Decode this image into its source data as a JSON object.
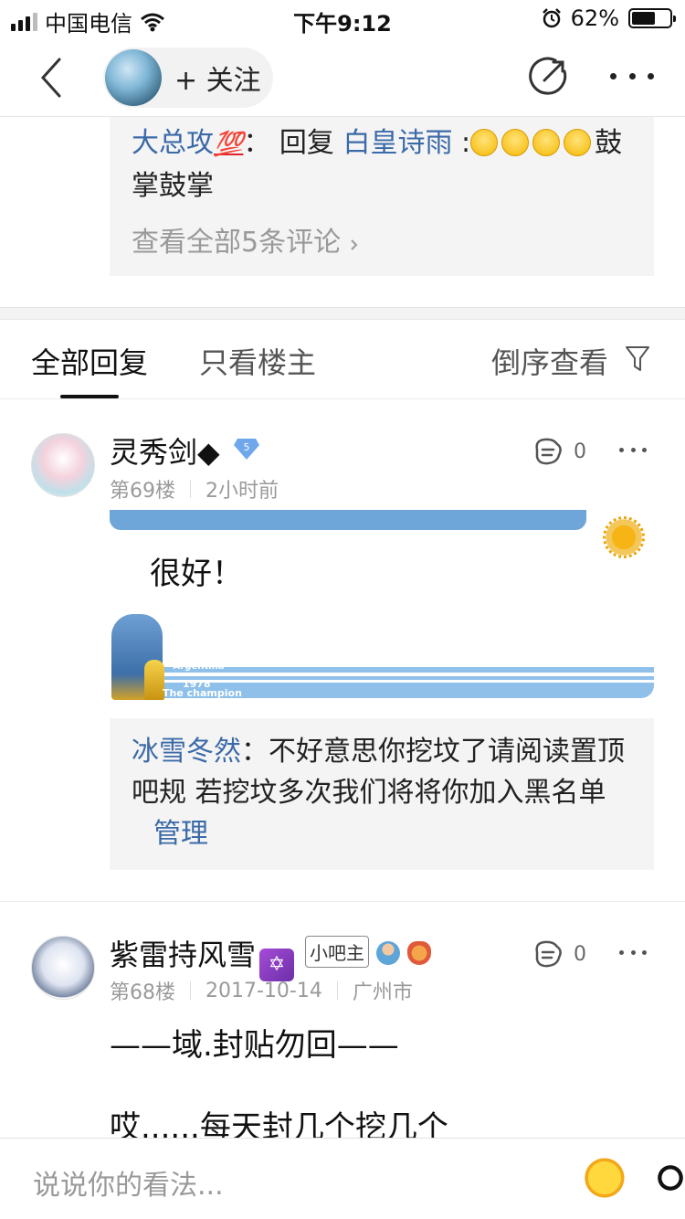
{
  "status_bar": {
    "carrier": "中国电信",
    "time": "下午9:12",
    "battery_percent": "62%",
    "battery_level": 0.62
  },
  "nav": {
    "follow_label": "+ 关注"
  },
  "sub_comment": {
    "author": "大总攻",
    "author_emoji": "💯",
    "separator": "：",
    "reply_word": "回复",
    "reply_to": "白皇诗雨",
    "reply_text": ":",
    "tail_text": "鼓掌鼓掌",
    "view_all": "查看全部5条评论"
  },
  "tabs": {
    "all": "全部回复",
    "op_only": "只看楼主",
    "sort": "倒序查看"
  },
  "post1": {
    "name": "灵秀剑◆",
    "level": "5",
    "floor": "第69楼",
    "time": "2小时前",
    "likes": "0",
    "text": "很好！",
    "banner": {
      "brand": "Argentina",
      "year": "1978",
      "title": "The champion"
    },
    "notice": {
      "author": "冰雪冬然",
      "separator": "：",
      "text": "不好意思你挖坟了请阅读置顶吧规 若挖坟多次我们将将你加入黑名单",
      "role": "管理"
    }
  },
  "post2": {
    "name": "紫雷持风雪",
    "role_badge": "小吧主",
    "floor": "第68楼",
    "date": "2017-10-14",
    "location": "广州市",
    "likes": "0",
    "line1": "——域.封贴勿回——",
    "line2": "哎......每天封几个挖几个"
  },
  "input": {
    "placeholder": "说说你的看法..."
  }
}
